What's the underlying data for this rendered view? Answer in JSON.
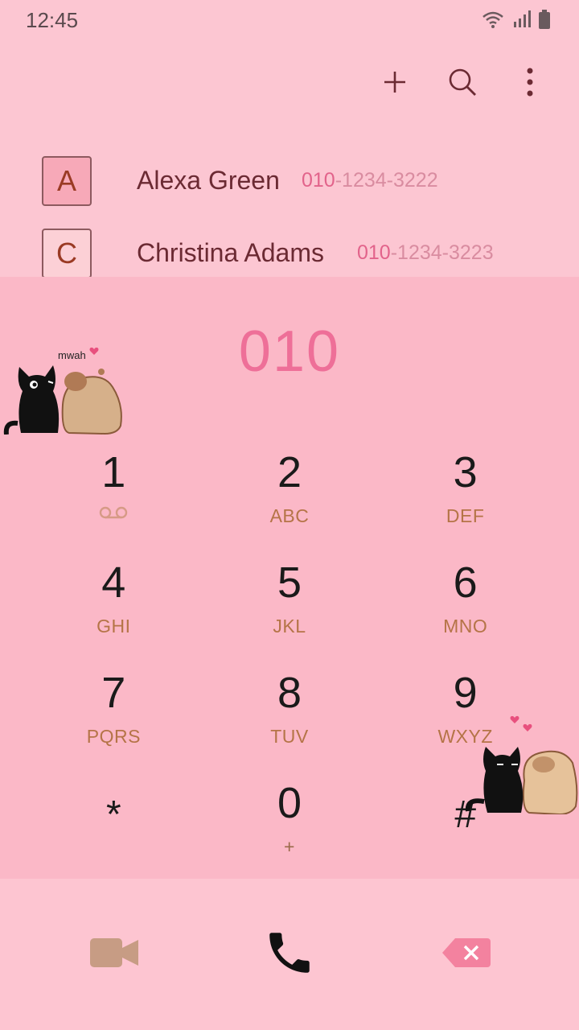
{
  "status_bar": {
    "time": "12:45",
    "icons": [
      "wifi-icon",
      "signal-icon",
      "battery-icon"
    ]
  },
  "toolbar": {
    "add_icon": "plus-icon",
    "search_icon": "search-icon",
    "more_icon": "more-vertical-icon"
  },
  "contacts": [
    {
      "initial": "A",
      "name": "Alexa Green",
      "number_match": "010",
      "number_rest": "-1234-3222"
    },
    {
      "initial": "C",
      "name": "Christina Adams",
      "number_match": "010",
      "number_rest": "-1234-3223"
    }
  ],
  "dial": {
    "entered": "010"
  },
  "stickers": {
    "top_caption": "mwah"
  },
  "keys": [
    {
      "digit": "1",
      "letters": ""
    },
    {
      "digit": "2",
      "letters": "ABC"
    },
    {
      "digit": "3",
      "letters": "DEF"
    },
    {
      "digit": "4",
      "letters": "GHI"
    },
    {
      "digit": "5",
      "letters": "JKL"
    },
    {
      "digit": "6",
      "letters": "MNO"
    },
    {
      "digit": "7",
      "letters": "PQRS"
    },
    {
      "digit": "8",
      "letters": "TUV"
    },
    {
      "digit": "9",
      "letters": "WXYZ"
    },
    {
      "digit": "*",
      "letters": ""
    },
    {
      "digit": "0",
      "letters": "+"
    },
    {
      "digit": "#",
      "letters": ""
    }
  ],
  "actions": {
    "video_call_icon": "video-camera-icon",
    "call_icon": "phone-icon",
    "backspace_icon": "backspace-icon"
  },
  "colors": {
    "background": "#fcc6d2",
    "dialpad_background": "#fbb8c7",
    "accent": "#ee6f98",
    "letters": "#b57447",
    "video_icon": "#c79c84",
    "backspace_icon": "#f3829f"
  }
}
